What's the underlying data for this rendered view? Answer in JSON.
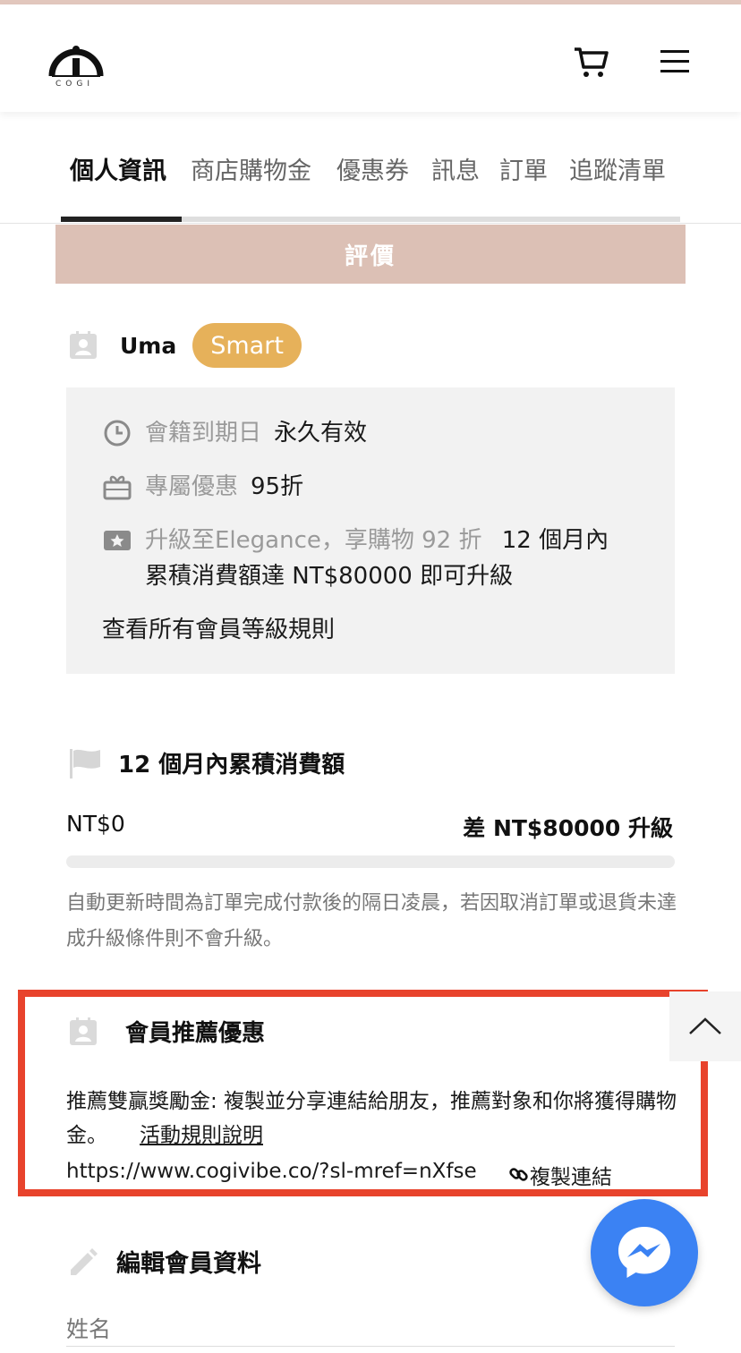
{
  "header": {
    "logo_text": "COGI",
    "cart_icon": "cart-icon",
    "menu_icon": "hamburger-icon"
  },
  "tabs": [
    {
      "label": "個人資訊",
      "active": true
    },
    {
      "label": "商店購物金",
      "active": false
    },
    {
      "label": "優惠券",
      "active": false
    },
    {
      "label": "訊息",
      "active": false
    },
    {
      "label": "訂單",
      "active": false
    },
    {
      "label": "追蹤清單",
      "active": false
    }
  ],
  "review_button": "評價",
  "member": {
    "name": "Uma",
    "tier": "Smart",
    "expiry_label": "會籍到期日",
    "expiry_value": "永久有效",
    "discount_label": "專屬優惠",
    "discount_value": "95折",
    "upgrade_label": "升級至Elegance，享購物 92 折",
    "upgrade_value_line1": "12 個月內",
    "upgrade_value_line2": "累積消費額達 NT$80000 即可升級",
    "rules_link": "查看所有會員等級規則"
  },
  "spending": {
    "title": "12 個月內累積消費額",
    "current": "NT$0",
    "gap": "差 NT$80000 升級",
    "progress_fraction": 0,
    "note": "自動更新時間為訂單完成付款後的隔日凌晨，若因取消訂單或退貨未達成升級條件則不會升級。"
  },
  "referral": {
    "title": "會員推薦優惠",
    "description": "推薦雙贏獎勵金: 複製並分享連結給朋友，推薦對象和你將獲得購物金。",
    "rules_link": "活動規則說明",
    "url": "https://www.cogivibe.co/?sl-mref=nXfse",
    "copy_label": "複製連結"
  },
  "edit_profile": {
    "title": "編輯會員資料",
    "name_label": "姓名"
  },
  "colors": {
    "accent_pink": "#dcc0b5",
    "tier_gold": "#e6b15a",
    "highlight_red": "#e8432c",
    "messenger_blue": "#3b82f3"
  }
}
